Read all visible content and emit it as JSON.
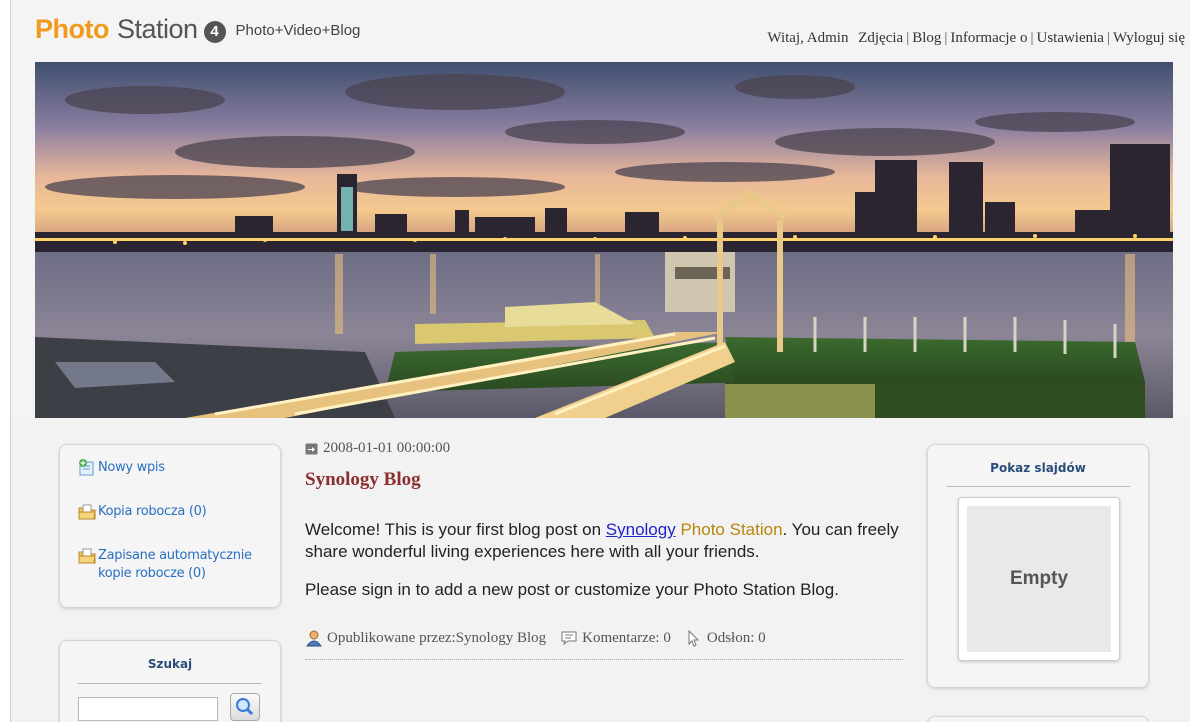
{
  "header": {
    "logo_photo": "Photo",
    "logo_station": "Station",
    "logo_version": "4",
    "tagline": "Photo+Video+Blog",
    "welcome": "Witaj, Admin",
    "nav": [
      "Zdjęcia",
      "Blog",
      "Informacje o",
      "Ustawienia",
      "Wyloguj się"
    ]
  },
  "sidebar_left": {
    "new_post": "Nowy wpis",
    "draft": "Kopia robocza (0)",
    "autosave_line1": "Zapisane automatycznie",
    "autosave_line2": "kopie robocze (0)",
    "search_title": "Szukaj",
    "search_value": ""
  },
  "post": {
    "date": "2008-01-01 00:00:00",
    "title": "Synology Blog",
    "p1_before": "Welcome! This is your first blog post on ",
    "p1_link": "Synology",
    "p1_brand": "Photo Station",
    "p1_after": ". You can freely share wonderful living experiences here with all your friends.",
    "p2": "Please sign in to add a new post or customize your Photo Station Blog.",
    "author": "Opublikowane przez:Synology Blog",
    "comments": "Komentarze: 0",
    "views": "Odsłon: 0"
  },
  "sidebar_right": {
    "slideshow_title": "Pokaz slajdów",
    "empty_label": "Empty"
  },
  "colors": {
    "logo_orange": "#f29a1d",
    "link_blue": "#2a6fc1",
    "title_red": "#8a2e2e"
  },
  "icons": [
    "new-post-icon",
    "folder-draft-icon",
    "folder-autosave-icon",
    "search-icon",
    "calendar-icon",
    "user-icon",
    "comment-icon",
    "cursor-icon"
  ]
}
